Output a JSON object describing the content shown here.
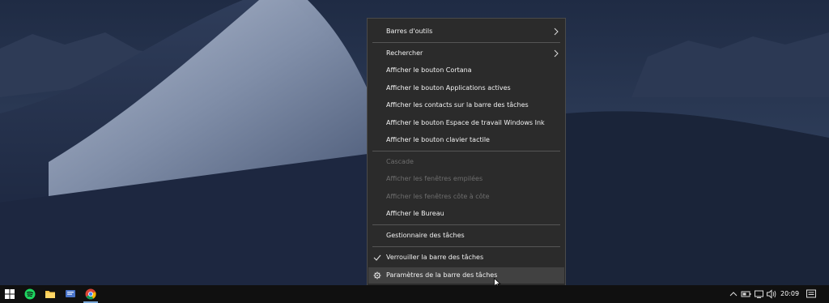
{
  "context_menu": {
    "items": [
      {
        "label": "Barres d'outils",
        "submenu": true,
        "enabled": true
      },
      {
        "label": "Rechercher",
        "submenu": true,
        "enabled": true
      },
      {
        "label": "Afficher le bouton Cortana",
        "enabled": true
      },
      {
        "label": "Afficher le bouton Applications actives",
        "enabled": true
      },
      {
        "label": "Afficher les contacts sur la barre des tâches",
        "enabled": true
      },
      {
        "label": "Afficher le bouton Espace de travail Windows Ink",
        "enabled": true
      },
      {
        "label": "Afficher le bouton clavier tactile",
        "enabled": true
      },
      {
        "label": "Cascade",
        "enabled": false
      },
      {
        "label": "Afficher les fenêtres empilées",
        "enabled": false
      },
      {
        "label": "Afficher les fenêtres côte à côte",
        "enabled": false
      },
      {
        "label": "Afficher le Bureau",
        "enabled": true
      },
      {
        "label": "Gestionnaire des tâches",
        "enabled": true
      },
      {
        "label": "Verrouiller la barre des tâches",
        "enabled": true,
        "checked": true,
        "icon": "checkmark-icon"
      },
      {
        "label": "Paramètres de la barre des tâches",
        "enabled": true,
        "icon": "gear-icon",
        "hovered": true
      }
    ]
  },
  "taskbar": {
    "apps": [
      {
        "name": "windows-start-icon"
      },
      {
        "name": "spotify-icon"
      },
      {
        "name": "file-explorer-icon"
      },
      {
        "name": "chat-app-icon"
      },
      {
        "name": "chrome-icon",
        "active": true
      }
    ],
    "tray_icons": [
      "chevron-up-icon",
      "battery-icon",
      "network-icon",
      "volume-icon"
    ],
    "clock": "20:09",
    "notification_icon": "action-center-icon"
  },
  "colors": {
    "menu_bg": "#2b2b2b",
    "taskbar_bg": "#101010",
    "accent": "#7aa7d8"
  }
}
